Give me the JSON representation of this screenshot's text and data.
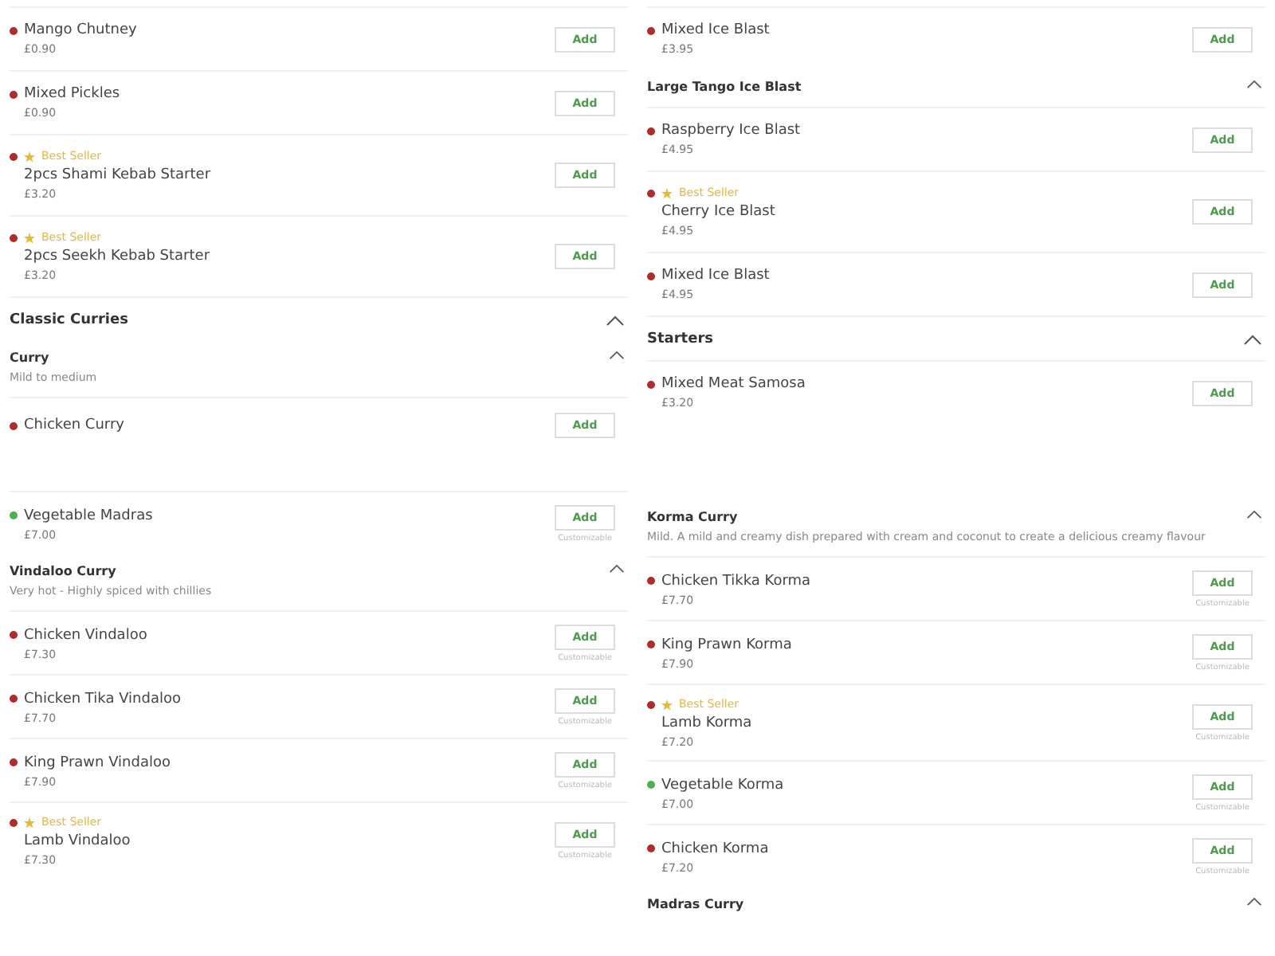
{
  "panels": [
    {
      "entries": [
        {
          "kind": "item",
          "name": "Mango Chutney",
          "price": "£0.90",
          "color": "#b22a2a",
          "best_seller": false,
          "button": "Add"
        },
        {
          "kind": "item",
          "name": "Mixed Pickles",
          "price": "£0.90",
          "color": "#b22a2a",
          "best_seller": false,
          "button": "Add"
        },
        {
          "kind": "item",
          "name": "2pcs Shami Kebab Starter",
          "price": "£3.20",
          "color": "#b22a2a",
          "best_seller": true,
          "badge": "Best Seller",
          "button": "Add"
        },
        {
          "kind": "item",
          "name": "2pcs Seekh Kebab Starter",
          "price": "£3.20",
          "color": "#b22a2a",
          "best_seller": true,
          "badge": "Best Seller",
          "button": "Add"
        },
        {
          "kind": "section",
          "title": "Classic Curries",
          "expanded": true
        },
        {
          "kind": "group",
          "title": "Curry",
          "description": "Mild to medium",
          "expanded": true
        },
        {
          "kind": "item",
          "name": "Chicken Curry",
          "color": "#b22a2a",
          "best_seller": false,
          "button": "Add"
        }
      ]
    },
    {
      "entries": [
        {
          "kind": "item",
          "name": "Mixed Ice Blast",
          "price": "£3.95",
          "color": "#b22a2a",
          "best_seller": false,
          "button": "Add"
        },
        {
          "kind": "group",
          "title": "Large Tango Ice Blast",
          "expanded": true
        },
        {
          "kind": "item",
          "name": "Raspberry Ice Blast",
          "price": "£4.95",
          "color": "#b22a2a",
          "best_seller": false,
          "button": "Add"
        },
        {
          "kind": "item",
          "name": "Cherry Ice Blast",
          "price": "£4.95",
          "color": "#b22a2a",
          "best_seller": true,
          "badge": "Best Seller",
          "button": "Add"
        },
        {
          "kind": "item",
          "name": "Mixed Ice Blast",
          "price": "£4.95",
          "color": "#b22a2a",
          "best_seller": false,
          "button": "Add"
        },
        {
          "kind": "section",
          "title": "Starters",
          "expanded": true
        },
        {
          "kind": "item",
          "name": "Mixed Meat Samosa",
          "price": "£3.20",
          "color": "#b22a2a",
          "best_seller": false,
          "button": "Add"
        }
      ]
    },
    {
      "entries": [
        {
          "kind": "item",
          "name": "Vegetable Madras",
          "price": "£7.00",
          "color": "#4caf50",
          "best_seller": false,
          "button": "Add",
          "note": "Customizable"
        },
        {
          "kind": "group",
          "title": "Vindaloo Curry",
          "description": "Very hot - Highly spiced with chillies",
          "expanded": true
        },
        {
          "kind": "item",
          "name": "Chicken Vindaloo",
          "price": "£7.30",
          "color": "#b22a2a",
          "best_seller": false,
          "button": "Add",
          "note": "Customizable"
        },
        {
          "kind": "item",
          "name": "Chicken Tika Vindaloo",
          "price": "£7.70",
          "color": "#b22a2a",
          "best_seller": false,
          "button": "Add",
          "note": "Customizable"
        },
        {
          "kind": "item",
          "name": "King Prawn Vindaloo",
          "price": "£7.90",
          "color": "#b22a2a",
          "best_seller": false,
          "button": "Add",
          "note": "Customizable"
        },
        {
          "kind": "item",
          "name": "Lamb Vindaloo",
          "price": "£7.30",
          "color": "#b22a2a",
          "best_seller": true,
          "badge": "Best Seller",
          "button": "Add",
          "note": "Customizable"
        }
      ]
    },
    {
      "entries": [
        {
          "kind": "group",
          "title": "Korma Curry",
          "description": "Mild. A mild and creamy dish prepared with cream and coconut to create a delicious creamy flavour",
          "expanded": true
        },
        {
          "kind": "item",
          "name": "Chicken Tikka Korma",
          "price": "£7.70",
          "color": "#b22a2a",
          "best_seller": false,
          "button": "Add",
          "note": "Customizable"
        },
        {
          "kind": "item",
          "name": "King Prawn Korma",
          "price": "£7.90",
          "color": "#b22a2a",
          "best_seller": false,
          "button": "Add",
          "note": "Customizable"
        },
        {
          "kind": "item",
          "name": "Lamb Korma",
          "price": "£7.20",
          "color": "#b22a2a",
          "best_seller": true,
          "badge": "Best Seller",
          "button": "Add",
          "note": "Customizable"
        },
        {
          "kind": "item",
          "name": "Vegetable Korma",
          "price": "£7.00",
          "color": "#4caf50",
          "best_seller": false,
          "button": "Add",
          "note": "Customizable"
        },
        {
          "kind": "item",
          "name": "Chicken Korma",
          "price": "£7.20",
          "color": "#b22a2a",
          "best_seller": false,
          "button": "Add",
          "note": "Customizable"
        },
        {
          "kind": "group",
          "title": "Madras Curry",
          "expanded": true
        }
      ]
    }
  ]
}
